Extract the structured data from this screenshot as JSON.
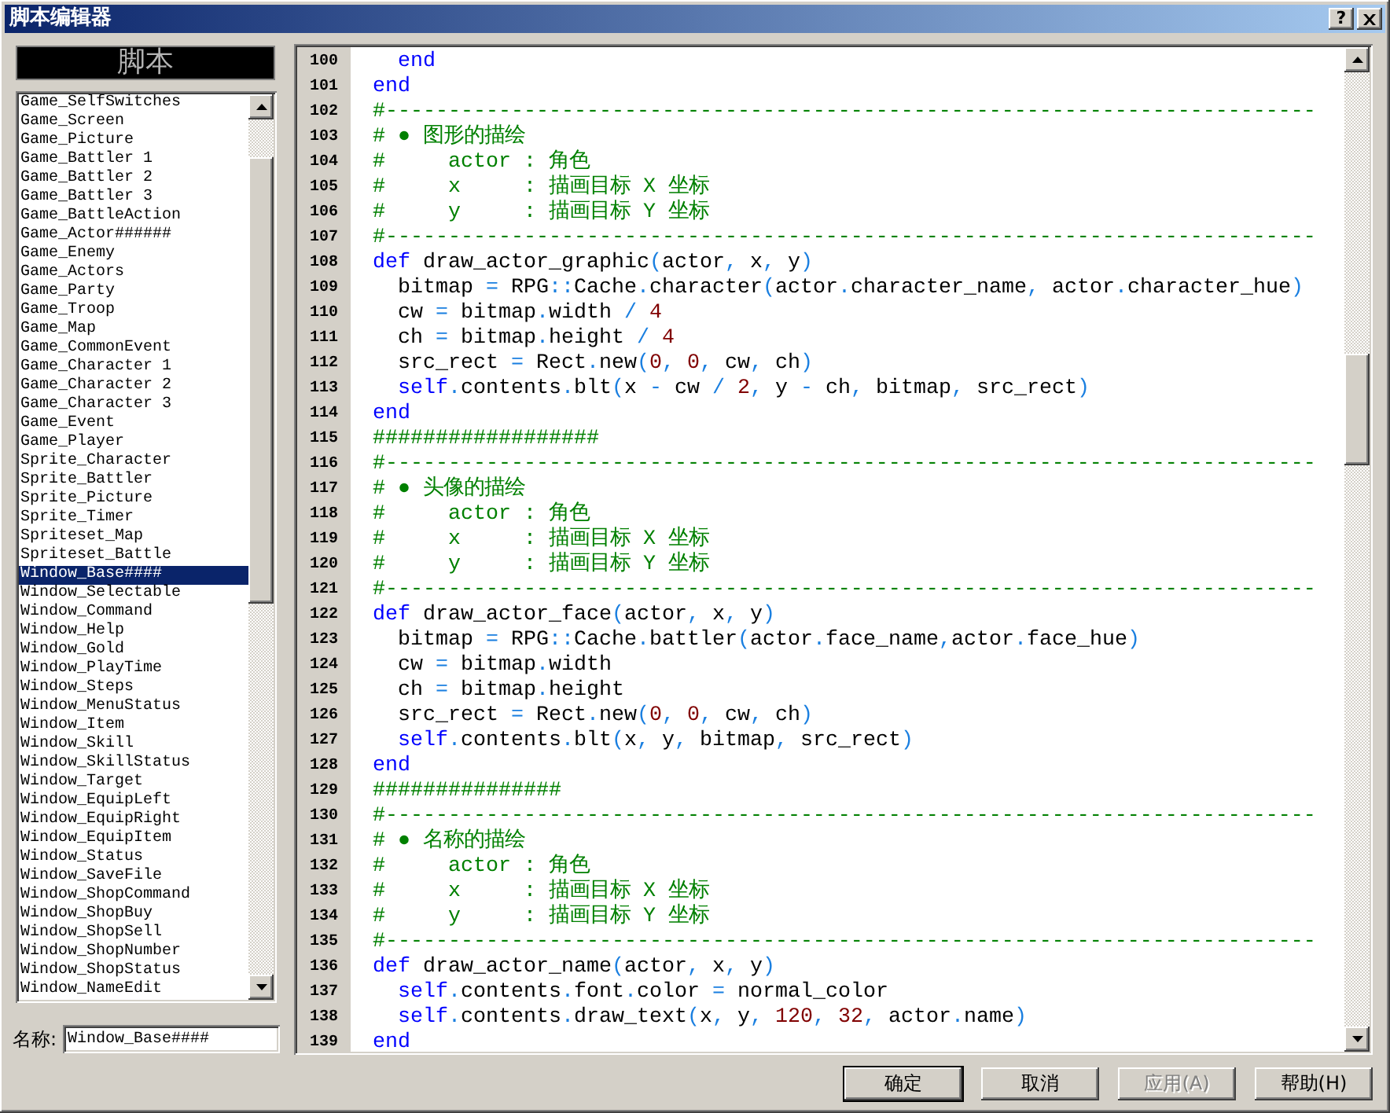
{
  "window": {
    "title": "脚本编辑器",
    "help_button": "?"
  },
  "script_list": {
    "header": "脚本",
    "items": [
      {
        "label": "Game_SelfSwitches",
        "selected": false
      },
      {
        "label": "Game_Screen",
        "selected": false
      },
      {
        "label": "Game_Picture",
        "selected": false
      },
      {
        "label": "Game_Battler 1",
        "selected": false
      },
      {
        "label": "Game_Battler 2",
        "selected": false
      },
      {
        "label": "Game_Battler 3",
        "selected": false
      },
      {
        "label": "Game_BattleAction",
        "selected": false
      },
      {
        "label": "Game_Actor######",
        "selected": false
      },
      {
        "label": "Game_Enemy",
        "selected": false
      },
      {
        "label": "Game_Actors",
        "selected": false
      },
      {
        "label": "Game_Party",
        "selected": false
      },
      {
        "label": "Game_Troop",
        "selected": false
      },
      {
        "label": "Game_Map",
        "selected": false
      },
      {
        "label": "Game_CommonEvent",
        "selected": false
      },
      {
        "label": "Game_Character 1",
        "selected": false
      },
      {
        "label": "Game_Character 2",
        "selected": false
      },
      {
        "label": "Game_Character 3",
        "selected": false
      },
      {
        "label": "Game_Event",
        "selected": false
      },
      {
        "label": "Game_Player",
        "selected": false
      },
      {
        "label": "Sprite_Character",
        "selected": false
      },
      {
        "label": "Sprite_Battler",
        "selected": false
      },
      {
        "label": "Sprite_Picture",
        "selected": false
      },
      {
        "label": "Sprite_Timer",
        "selected": false
      },
      {
        "label": "Spriteset_Map",
        "selected": false
      },
      {
        "label": "Spriteset_Battle",
        "selected": false
      },
      {
        "label": "Window_Base####",
        "selected": true
      },
      {
        "label": "Window_Selectable",
        "selected": false
      },
      {
        "label": "Window_Command",
        "selected": false
      },
      {
        "label": "Window_Help",
        "selected": false
      },
      {
        "label": "Window_Gold",
        "selected": false
      },
      {
        "label": "Window_PlayTime",
        "selected": false
      },
      {
        "label": "Window_Steps",
        "selected": false
      },
      {
        "label": "Window_MenuStatus",
        "selected": false
      },
      {
        "label": "Window_Item",
        "selected": false
      },
      {
        "label": "Window_Skill",
        "selected": false
      },
      {
        "label": "Window_SkillStatus",
        "selected": false
      },
      {
        "label": "Window_Target",
        "selected": false
      },
      {
        "label": "Window_EquipLeft",
        "selected": false
      },
      {
        "label": "Window_EquipRight",
        "selected": false
      },
      {
        "label": "Window_EquipItem",
        "selected": false
      },
      {
        "label": "Window_Status",
        "selected": false
      },
      {
        "label": "Window_SaveFile",
        "selected": false
      },
      {
        "label": "Window_ShopCommand",
        "selected": false
      },
      {
        "label": "Window_ShopBuy",
        "selected": false
      },
      {
        "label": "Window_ShopSell",
        "selected": false
      },
      {
        "label": "Window_ShopNumber",
        "selected": false
      },
      {
        "label": "Window_ShopStatus",
        "selected": false
      },
      {
        "label": "Window_NameEdit",
        "selected": false
      }
    ]
  },
  "name_field": {
    "label": "名称:",
    "value": "Window_Base####"
  },
  "editor": {
    "lines": [
      {
        "number": "100",
        "tokens": [
          {
            "kind": "keyword",
            "text": "  end"
          }
        ]
      },
      {
        "number": "101",
        "tokens": [
          {
            "kind": "keyword",
            "text": "end"
          }
        ]
      },
      {
        "number": "102",
        "tokens": [
          {
            "kind": "comment",
            "text": "#--------------------------------------------------------------------------"
          }
        ]
      },
      {
        "number": "103",
        "tokens": [
          {
            "kind": "comment",
            "text": "# ● 图形的描绘"
          }
        ]
      },
      {
        "number": "104",
        "tokens": [
          {
            "kind": "comment",
            "text": "#     actor : 角色"
          }
        ]
      },
      {
        "number": "105",
        "tokens": [
          {
            "kind": "comment",
            "text": "#     x     : 描画目标 X 坐标"
          }
        ]
      },
      {
        "number": "106",
        "tokens": [
          {
            "kind": "comment",
            "text": "#     y     : 描画目标 Y 坐标"
          }
        ]
      },
      {
        "number": "107",
        "tokens": [
          {
            "kind": "comment",
            "text": "#--------------------------------------------------------------------------"
          }
        ]
      },
      {
        "number": "108",
        "tokens": [
          {
            "kind": "keyword",
            "text": "def"
          },
          {
            "kind": "plain",
            "text": " draw_actor_graphic"
          },
          {
            "kind": "symbol",
            "text": "("
          },
          {
            "kind": "plain",
            "text": "actor"
          },
          {
            "kind": "symbol",
            "text": ","
          },
          {
            "kind": "plain",
            "text": " x"
          },
          {
            "kind": "symbol",
            "text": ","
          },
          {
            "kind": "plain",
            "text": " y"
          },
          {
            "kind": "symbol",
            "text": ")"
          }
        ]
      },
      {
        "number": "109",
        "tokens": [
          {
            "kind": "plain",
            "text": "  bitmap "
          },
          {
            "kind": "symbol",
            "text": "="
          },
          {
            "kind": "plain",
            "text": " RPG"
          },
          {
            "kind": "symbol",
            "text": "::"
          },
          {
            "kind": "plain",
            "text": "Cache"
          },
          {
            "kind": "symbol",
            "text": "."
          },
          {
            "kind": "plain",
            "text": "character"
          },
          {
            "kind": "symbol",
            "text": "("
          },
          {
            "kind": "plain",
            "text": "actor"
          },
          {
            "kind": "symbol",
            "text": "."
          },
          {
            "kind": "plain",
            "text": "character_name"
          },
          {
            "kind": "symbol",
            "text": ","
          },
          {
            "kind": "plain",
            "text": " actor"
          },
          {
            "kind": "symbol",
            "text": "."
          },
          {
            "kind": "plain",
            "text": "character_hue"
          },
          {
            "kind": "symbol",
            "text": ")"
          }
        ]
      },
      {
        "number": "110",
        "tokens": [
          {
            "kind": "plain",
            "text": "  cw "
          },
          {
            "kind": "symbol",
            "text": "="
          },
          {
            "kind": "plain",
            "text": " bitmap"
          },
          {
            "kind": "symbol",
            "text": "."
          },
          {
            "kind": "plain",
            "text": "width "
          },
          {
            "kind": "symbol",
            "text": "/"
          },
          {
            "kind": "number",
            "text": " 4"
          }
        ]
      },
      {
        "number": "111",
        "tokens": [
          {
            "kind": "plain",
            "text": "  ch "
          },
          {
            "kind": "symbol",
            "text": "="
          },
          {
            "kind": "plain",
            "text": " bitmap"
          },
          {
            "kind": "symbol",
            "text": "."
          },
          {
            "kind": "plain",
            "text": "height "
          },
          {
            "kind": "symbol",
            "text": "/"
          },
          {
            "kind": "number",
            "text": " 4"
          }
        ]
      },
      {
        "number": "112",
        "tokens": [
          {
            "kind": "plain",
            "text": "  src_rect "
          },
          {
            "kind": "symbol",
            "text": "="
          },
          {
            "kind": "plain",
            "text": " Rect"
          },
          {
            "kind": "symbol",
            "text": "."
          },
          {
            "kind": "plain",
            "text": "new"
          },
          {
            "kind": "symbol",
            "text": "("
          },
          {
            "kind": "number",
            "text": "0"
          },
          {
            "kind": "symbol",
            "text": ","
          },
          {
            "kind": "number",
            "text": " 0"
          },
          {
            "kind": "symbol",
            "text": ","
          },
          {
            "kind": "plain",
            "text": " cw"
          },
          {
            "kind": "symbol",
            "text": ","
          },
          {
            "kind": "plain",
            "text": " ch"
          },
          {
            "kind": "symbol",
            "text": ")"
          }
        ]
      },
      {
        "number": "113",
        "tokens": [
          {
            "kind": "keyword",
            "text": "  self"
          },
          {
            "kind": "symbol",
            "text": "."
          },
          {
            "kind": "plain",
            "text": "contents"
          },
          {
            "kind": "symbol",
            "text": "."
          },
          {
            "kind": "plain",
            "text": "blt"
          },
          {
            "kind": "symbol",
            "text": "("
          },
          {
            "kind": "plain",
            "text": "x "
          },
          {
            "kind": "symbol",
            "text": "-"
          },
          {
            "kind": "plain",
            "text": " cw "
          },
          {
            "kind": "symbol",
            "text": "/"
          },
          {
            "kind": "number",
            "text": " 2"
          },
          {
            "kind": "symbol",
            "text": ","
          },
          {
            "kind": "plain",
            "text": " y "
          },
          {
            "kind": "symbol",
            "text": "-"
          },
          {
            "kind": "plain",
            "text": " ch"
          },
          {
            "kind": "symbol",
            "text": ","
          },
          {
            "kind": "plain",
            "text": " bitmap"
          },
          {
            "kind": "symbol",
            "text": ","
          },
          {
            "kind": "plain",
            "text": " src_rect"
          },
          {
            "kind": "symbol",
            "text": ")"
          }
        ]
      },
      {
        "number": "114",
        "tokens": [
          {
            "kind": "keyword",
            "text": "end"
          }
        ]
      },
      {
        "number": "115",
        "tokens": [
          {
            "kind": "comment",
            "text": "##################"
          }
        ]
      },
      {
        "number": "116",
        "tokens": [
          {
            "kind": "comment",
            "text": "#--------------------------------------------------------------------------"
          }
        ]
      },
      {
        "number": "117",
        "tokens": [
          {
            "kind": "comment",
            "text": "# ● 头像的描绘"
          }
        ]
      },
      {
        "number": "118",
        "tokens": [
          {
            "kind": "comment",
            "text": "#     actor : 角色"
          }
        ]
      },
      {
        "number": "119",
        "tokens": [
          {
            "kind": "comment",
            "text": "#     x     : 描画目标 X 坐标"
          }
        ]
      },
      {
        "number": "120",
        "tokens": [
          {
            "kind": "comment",
            "text": "#     y     : 描画目标 Y 坐标"
          }
        ]
      },
      {
        "number": "121",
        "tokens": [
          {
            "kind": "comment",
            "text": "#--------------------------------------------------------------------------"
          }
        ]
      },
      {
        "number": "122",
        "tokens": [
          {
            "kind": "keyword",
            "text": "def"
          },
          {
            "kind": "plain",
            "text": " draw_actor_face"
          },
          {
            "kind": "symbol",
            "text": "("
          },
          {
            "kind": "plain",
            "text": "actor"
          },
          {
            "kind": "symbol",
            "text": ","
          },
          {
            "kind": "plain",
            "text": " x"
          },
          {
            "kind": "symbol",
            "text": ","
          },
          {
            "kind": "plain",
            "text": " y"
          },
          {
            "kind": "symbol",
            "text": ")"
          }
        ]
      },
      {
        "number": "123",
        "tokens": [
          {
            "kind": "plain",
            "text": "  bitmap "
          },
          {
            "kind": "symbol",
            "text": "="
          },
          {
            "kind": "plain",
            "text": " RPG"
          },
          {
            "kind": "symbol",
            "text": "::"
          },
          {
            "kind": "plain",
            "text": "Cache"
          },
          {
            "kind": "symbol",
            "text": "."
          },
          {
            "kind": "plain",
            "text": "battler"
          },
          {
            "kind": "symbol",
            "text": "("
          },
          {
            "kind": "plain",
            "text": "actor"
          },
          {
            "kind": "symbol",
            "text": "."
          },
          {
            "kind": "plain",
            "text": "face_name"
          },
          {
            "kind": "symbol",
            "text": ","
          },
          {
            "kind": "plain",
            "text": "actor"
          },
          {
            "kind": "symbol",
            "text": "."
          },
          {
            "kind": "plain",
            "text": "face_hue"
          },
          {
            "kind": "symbol",
            "text": ")"
          }
        ]
      },
      {
        "number": "124",
        "tokens": [
          {
            "kind": "plain",
            "text": "  cw "
          },
          {
            "kind": "symbol",
            "text": "="
          },
          {
            "kind": "plain",
            "text": " bitmap"
          },
          {
            "kind": "symbol",
            "text": "."
          },
          {
            "kind": "plain",
            "text": "width"
          }
        ]
      },
      {
        "number": "125",
        "tokens": [
          {
            "kind": "plain",
            "text": "  ch "
          },
          {
            "kind": "symbol",
            "text": "="
          },
          {
            "kind": "plain",
            "text": " bitmap"
          },
          {
            "kind": "symbol",
            "text": "."
          },
          {
            "kind": "plain",
            "text": "height"
          }
        ]
      },
      {
        "number": "126",
        "tokens": [
          {
            "kind": "plain",
            "text": "  src_rect "
          },
          {
            "kind": "symbol",
            "text": "="
          },
          {
            "kind": "plain",
            "text": " Rect"
          },
          {
            "kind": "symbol",
            "text": "."
          },
          {
            "kind": "plain",
            "text": "new"
          },
          {
            "kind": "symbol",
            "text": "("
          },
          {
            "kind": "number",
            "text": "0"
          },
          {
            "kind": "symbol",
            "text": ","
          },
          {
            "kind": "number",
            "text": " 0"
          },
          {
            "kind": "symbol",
            "text": ","
          },
          {
            "kind": "plain",
            "text": " cw"
          },
          {
            "kind": "symbol",
            "text": ","
          },
          {
            "kind": "plain",
            "text": " ch"
          },
          {
            "kind": "symbol",
            "text": ")"
          }
        ]
      },
      {
        "number": "127",
        "tokens": [
          {
            "kind": "keyword",
            "text": "  self"
          },
          {
            "kind": "symbol",
            "text": "."
          },
          {
            "kind": "plain",
            "text": "contents"
          },
          {
            "kind": "symbol",
            "text": "."
          },
          {
            "kind": "plain",
            "text": "blt"
          },
          {
            "kind": "symbol",
            "text": "("
          },
          {
            "kind": "plain",
            "text": "x"
          },
          {
            "kind": "symbol",
            "text": ","
          },
          {
            "kind": "plain",
            "text": " y"
          },
          {
            "kind": "symbol",
            "text": ","
          },
          {
            "kind": "plain",
            "text": " bitmap"
          },
          {
            "kind": "symbol",
            "text": ","
          },
          {
            "kind": "plain",
            "text": " src_rect"
          },
          {
            "kind": "symbol",
            "text": ")"
          }
        ]
      },
      {
        "number": "128",
        "tokens": [
          {
            "kind": "keyword",
            "text": "end"
          }
        ]
      },
      {
        "number": "129",
        "tokens": [
          {
            "kind": "comment",
            "text": "###############"
          }
        ]
      },
      {
        "number": "130",
        "tokens": [
          {
            "kind": "comment",
            "text": "#--------------------------------------------------------------------------"
          }
        ]
      },
      {
        "number": "131",
        "tokens": [
          {
            "kind": "comment",
            "text": "# ● 名称的描绘"
          }
        ]
      },
      {
        "number": "132",
        "tokens": [
          {
            "kind": "comment",
            "text": "#     actor : 角色"
          }
        ]
      },
      {
        "number": "133",
        "tokens": [
          {
            "kind": "comment",
            "text": "#     x     : 描画目标 X 坐标"
          }
        ]
      },
      {
        "number": "134",
        "tokens": [
          {
            "kind": "comment",
            "text": "#     y     : 描画目标 Y 坐标"
          }
        ]
      },
      {
        "number": "135",
        "tokens": [
          {
            "kind": "comment",
            "text": "#--------------------------------------------------------------------------"
          }
        ]
      },
      {
        "number": "136",
        "tokens": [
          {
            "kind": "keyword",
            "text": "def"
          },
          {
            "kind": "plain",
            "text": " draw_actor_name"
          },
          {
            "kind": "symbol",
            "text": "("
          },
          {
            "kind": "plain",
            "text": "actor"
          },
          {
            "kind": "symbol",
            "text": ","
          },
          {
            "kind": "plain",
            "text": " x"
          },
          {
            "kind": "symbol",
            "text": ","
          },
          {
            "kind": "plain",
            "text": " y"
          },
          {
            "kind": "symbol",
            "text": ")"
          }
        ]
      },
      {
        "number": "137",
        "tokens": [
          {
            "kind": "keyword",
            "text": "  self"
          },
          {
            "kind": "symbol",
            "text": "."
          },
          {
            "kind": "plain",
            "text": "contents"
          },
          {
            "kind": "symbol",
            "text": "."
          },
          {
            "kind": "plain",
            "text": "font"
          },
          {
            "kind": "symbol",
            "text": "."
          },
          {
            "kind": "plain",
            "text": "color "
          },
          {
            "kind": "symbol",
            "text": "="
          },
          {
            "kind": "plain",
            "text": " normal_color"
          }
        ]
      },
      {
        "number": "138",
        "tokens": [
          {
            "kind": "keyword",
            "text": "  self"
          },
          {
            "kind": "symbol",
            "text": "."
          },
          {
            "kind": "plain",
            "text": "contents"
          },
          {
            "kind": "symbol",
            "text": "."
          },
          {
            "kind": "plain",
            "text": "draw_text"
          },
          {
            "kind": "symbol",
            "text": "("
          },
          {
            "kind": "plain",
            "text": "x"
          },
          {
            "kind": "symbol",
            "text": ","
          },
          {
            "kind": "plain",
            "text": " y"
          },
          {
            "kind": "symbol",
            "text": ","
          },
          {
            "kind": "number",
            "text": " 120"
          },
          {
            "kind": "symbol",
            "text": ","
          },
          {
            "kind": "number",
            "text": " 32"
          },
          {
            "kind": "symbol",
            "text": ","
          },
          {
            "kind": "plain",
            "text": " actor"
          },
          {
            "kind": "symbol",
            "text": "."
          },
          {
            "kind": "plain",
            "text": "name"
          },
          {
            "kind": "symbol",
            "text": ")"
          }
        ]
      },
      {
        "number": "139",
        "tokens": [
          {
            "kind": "keyword",
            "text": "end"
          }
        ]
      }
    ]
  },
  "buttons": [
    {
      "label": "确定",
      "default": true,
      "disabled": false
    },
    {
      "label": "取消",
      "default": false,
      "disabled": false
    },
    {
      "label": "应用(A)",
      "default": false,
      "disabled": true
    },
    {
      "label": "帮助(H)",
      "default": false,
      "disabled": false
    }
  ]
}
